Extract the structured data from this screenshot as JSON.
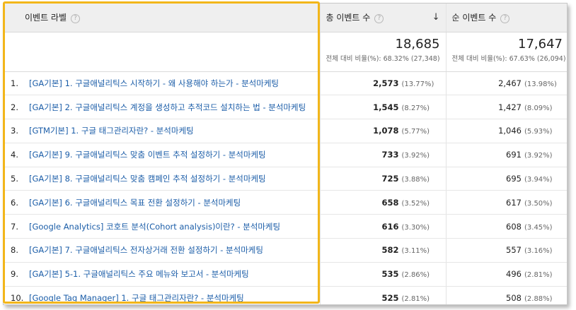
{
  "colors": {
    "highlight": "#f2b61a",
    "link": "#1b5da8",
    "header_bg": "#efefef"
  },
  "header": {
    "col1_label": "이벤트 라벨",
    "col2_label": "총 이벤트 수",
    "col3_label": "순 이벤트 수",
    "help_glyph": "?",
    "sort_glyph": "↓",
    "help_icon": "question-circle-icon",
    "sort_icon": "sort-descending-arrow-icon"
  },
  "summary": {
    "total": {
      "value": "18,685",
      "sub": "전체 대비 비율(%): 68.32% (27,348)"
    },
    "unique": {
      "value": "17,647",
      "sub": "전체 대비 비율(%): 67.63% (26,094)"
    }
  },
  "rows": [
    {
      "rank": "1.",
      "label": "[GA기본] 1. 구글애널리틱스 시작하기 - 왜 사용해야 하는가 - 분석마케팅",
      "total": "2,573",
      "total_pct": "(13.77%)",
      "unique": "2,467",
      "unique_pct": "(13.98%)"
    },
    {
      "rank": "2.",
      "label": "[GA기본] 2. 구글애널리틱스 계정을 생성하고 추적코드 설치하는 법 - 분석마케팅",
      "total": "1,545",
      "total_pct": "(8.27%)",
      "unique": "1,427",
      "unique_pct": "(8.09%)"
    },
    {
      "rank": "3.",
      "label": "[GTM기본] 1. 구글 태그관리자란? - 분석마케팅",
      "total": "1,078",
      "total_pct": "(5.77%)",
      "unique": "1,046",
      "unique_pct": "(5.93%)"
    },
    {
      "rank": "4.",
      "label": "[GA기본] 9. 구글애널리틱스 맞춤 이벤트 추적 설정하기 - 분석마케팅",
      "total": "733",
      "total_pct": "(3.92%)",
      "unique": "691",
      "unique_pct": "(3.92%)"
    },
    {
      "rank": "5.",
      "label": "[GA기본] 8. 구글애널리틱스 맞춤 캠페인 추적 설정하기 - 분석마케팅",
      "total": "725",
      "total_pct": "(3.88%)",
      "unique": "695",
      "unique_pct": "(3.94%)"
    },
    {
      "rank": "6.",
      "label": "[GA기본] 6. 구글애널리틱스 목표 전환 설정하기 - 분석마케팅",
      "total": "658",
      "total_pct": "(3.52%)",
      "unique": "617",
      "unique_pct": "(3.50%)"
    },
    {
      "rank": "7.",
      "label": "[Google Analytics] 코호트 분석(Cohort analysis)이란? - 분석마케팅",
      "total": "616",
      "total_pct": "(3.30%)",
      "unique": "608",
      "unique_pct": "(3.45%)"
    },
    {
      "rank": "8.",
      "label": "[GA기본] 7. 구글애널리틱스 전자상거래 전환 설정하기 - 분석마케팅",
      "total": "582",
      "total_pct": "(3.11%)",
      "unique": "557",
      "unique_pct": "(3.16%)"
    },
    {
      "rank": "9.",
      "label": "[GA기본] 5-1. 구글애널리틱스 주요 메뉴와 보고서 - 분석마케팅",
      "total": "535",
      "total_pct": "(2.86%)",
      "unique": "496",
      "unique_pct": "(2.81%)"
    },
    {
      "rank": "10.",
      "label": "[Google Tag Manager] 1. 구글 태그관리자란? - 분석마케팅",
      "total": "525",
      "total_pct": "(2.81%)",
      "unique": "508",
      "unique_pct": "(2.88%)"
    }
  ]
}
